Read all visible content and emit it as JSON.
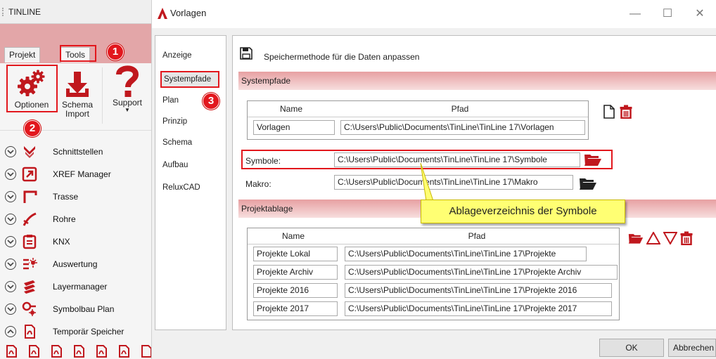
{
  "left_panel": {
    "title": "TINLINE",
    "tabs": [
      "Projekt",
      "Tools"
    ],
    "ribbon_buttons": {
      "options": "Optionen",
      "schema_import_line1": "Schema",
      "schema_import_line2": "Import",
      "support": "Support"
    },
    "feature_items": [
      {
        "label": "Schnittstellen",
        "icon": "interface-icon"
      },
      {
        "label": "XREF Manager",
        "icon": "xref-icon"
      },
      {
        "label": "Trasse",
        "icon": "route-icon"
      },
      {
        "label": "Rohre",
        "icon": "pipe-icon"
      },
      {
        "label": "KNX",
        "icon": "knx-icon"
      },
      {
        "label": "Auswertung",
        "icon": "evaluation-icon"
      },
      {
        "label": "Layermanager",
        "icon": "layer-icon"
      },
      {
        "label": "Symbolbau Plan",
        "icon": "symbol-build-icon"
      },
      {
        "label": "Temporär Speicher",
        "icon": "temp-storage-icon"
      }
    ]
  },
  "badges": [
    "1",
    "2",
    "3"
  ],
  "dialog": {
    "title": "Vorlagen",
    "nav_items": [
      "Anzeige",
      "Systempfade",
      "Plan",
      "Prinzip",
      "Schema",
      "Aufbau",
      "ReluxCAD"
    ],
    "selected_nav": "Systempfade",
    "save_method_label": "Speichermethode für die Daten anpassen",
    "systempfade": {
      "header": "Systempfade",
      "columns": [
        "Name",
        "Pfad"
      ],
      "rows": [
        {
          "name": "Vorlagen",
          "path": "C:\\Users\\Public\\Documents\\TinLine\\TinLine 17\\Vorlagen"
        }
      ],
      "symbole_label": "Symbole:",
      "symbole_path": "C:\\Users\\Public\\Documents\\TinLine\\TinLine 17\\Symbole",
      "makro_label": "Makro:",
      "makro_path": "C:\\Users\\Public\\Documents\\TinLine\\TinLine 17\\Makro"
    },
    "projektablage": {
      "header": "Projektablage",
      "columns": [
        "Name",
        "Pfad"
      ],
      "rows": [
        {
          "name": "Projekte Lokal",
          "path": "C:\\Users\\Public\\Documents\\TinLine\\TinLine 17\\Projekte"
        },
        {
          "name": "Projekte Archiv",
          "path": "C:\\Users\\Public\\Documents\\TinLine\\TinLine 17\\Projekte Archiv"
        },
        {
          "name": "Projekte 2016",
          "path": "C:\\Users\\Public\\Documents\\TinLine\\TinLine 17\\Projekte 2016"
        },
        {
          "name": "Projekte 2017",
          "path": "C:\\Users\\Public\\Documents\\TinLine\\TinLine 17\\Projekte 2017"
        }
      ]
    },
    "callout": "Ablageverzeichnis der Symbole",
    "ok_label": "OK",
    "cancel_label": "Abbrechen"
  },
  "colors": {
    "accent": "#e2171d",
    "header_band": "#e3a6a8",
    "callout": "#ffff73"
  }
}
